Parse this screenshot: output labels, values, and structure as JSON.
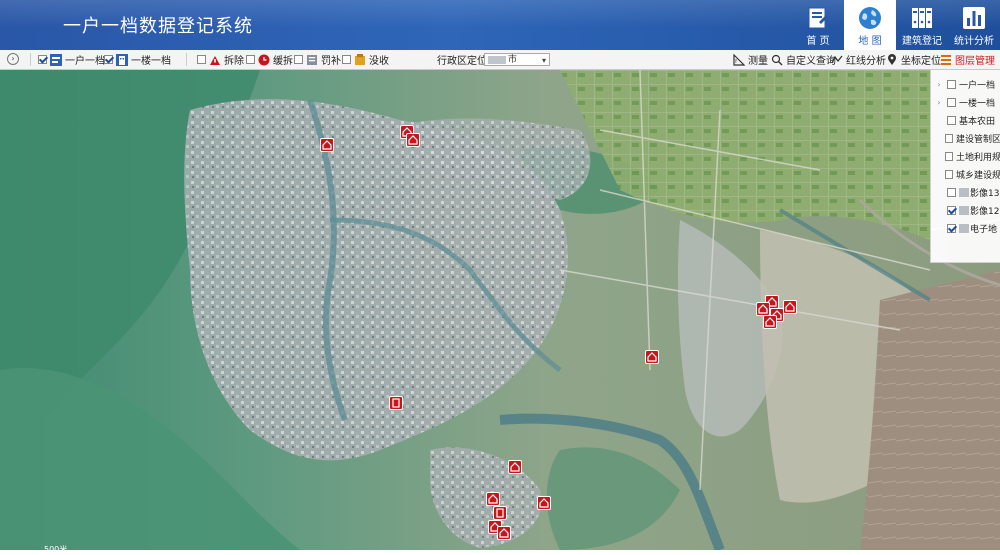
{
  "app": {
    "title": "一户一档数据登记系统"
  },
  "nav": [
    {
      "label": "首 页",
      "icon": "home-icon",
      "active": false
    },
    {
      "label": "地 图",
      "icon": "globe-icon",
      "active": true
    },
    {
      "label": "建筑登记",
      "icon": "building-register-icon",
      "active": false
    },
    {
      "label": "统计分析",
      "icon": "bar-chart-icon",
      "active": false
    }
  ],
  "toolbar": {
    "items": [
      {
        "label": "一户一档",
        "checked": true
      },
      {
        "label": "一楼一档",
        "checked": true
      },
      {
        "label": "拆除",
        "checked": false
      },
      {
        "label": "缓拆",
        "checked": false
      },
      {
        "label": "罚补",
        "checked": false
      },
      {
        "label": "没收",
        "checked": false
      }
    ],
    "district_label": "行政区定位:",
    "district_value": "市",
    "tools": [
      {
        "label": "测量",
        "icon": "ruler-icon"
      },
      {
        "label": "自定义查询",
        "icon": "query-icon"
      },
      {
        "label": "红线分析",
        "icon": "redline-icon"
      },
      {
        "label": "坐标定位",
        "icon": "location-pin-icon"
      },
      {
        "label": "图层管理",
        "icon": "layers-icon",
        "active": true
      }
    ]
  },
  "layers": [
    {
      "label": "一户一档",
      "checked": false,
      "expandable": true
    },
    {
      "label": "一楼一档",
      "checked": false,
      "expandable": true
    },
    {
      "label": "基本农田",
      "checked": false,
      "expandable": false
    },
    {
      "label": "建设管制区",
      "checked": false,
      "expandable": false
    },
    {
      "label": "土地利用规",
      "checked": false,
      "expandable": false
    },
    {
      "label": "城乡建设规",
      "checked": false,
      "expandable": false
    },
    {
      "label": "影像13",
      "checked": false,
      "expandable": false,
      "redacted": true
    },
    {
      "label": "影像12",
      "checked": true,
      "expandable": false,
      "redacted": true
    },
    {
      "label": "电子地",
      "checked": true,
      "expandable": false,
      "redacted": true
    }
  ],
  "map": {
    "scale_label": "500米",
    "marker_color": "#c7161b"
  },
  "colors": {
    "header": "#2a57a8",
    "accent": "#2a67b5",
    "marker": "#c7161b"
  }
}
